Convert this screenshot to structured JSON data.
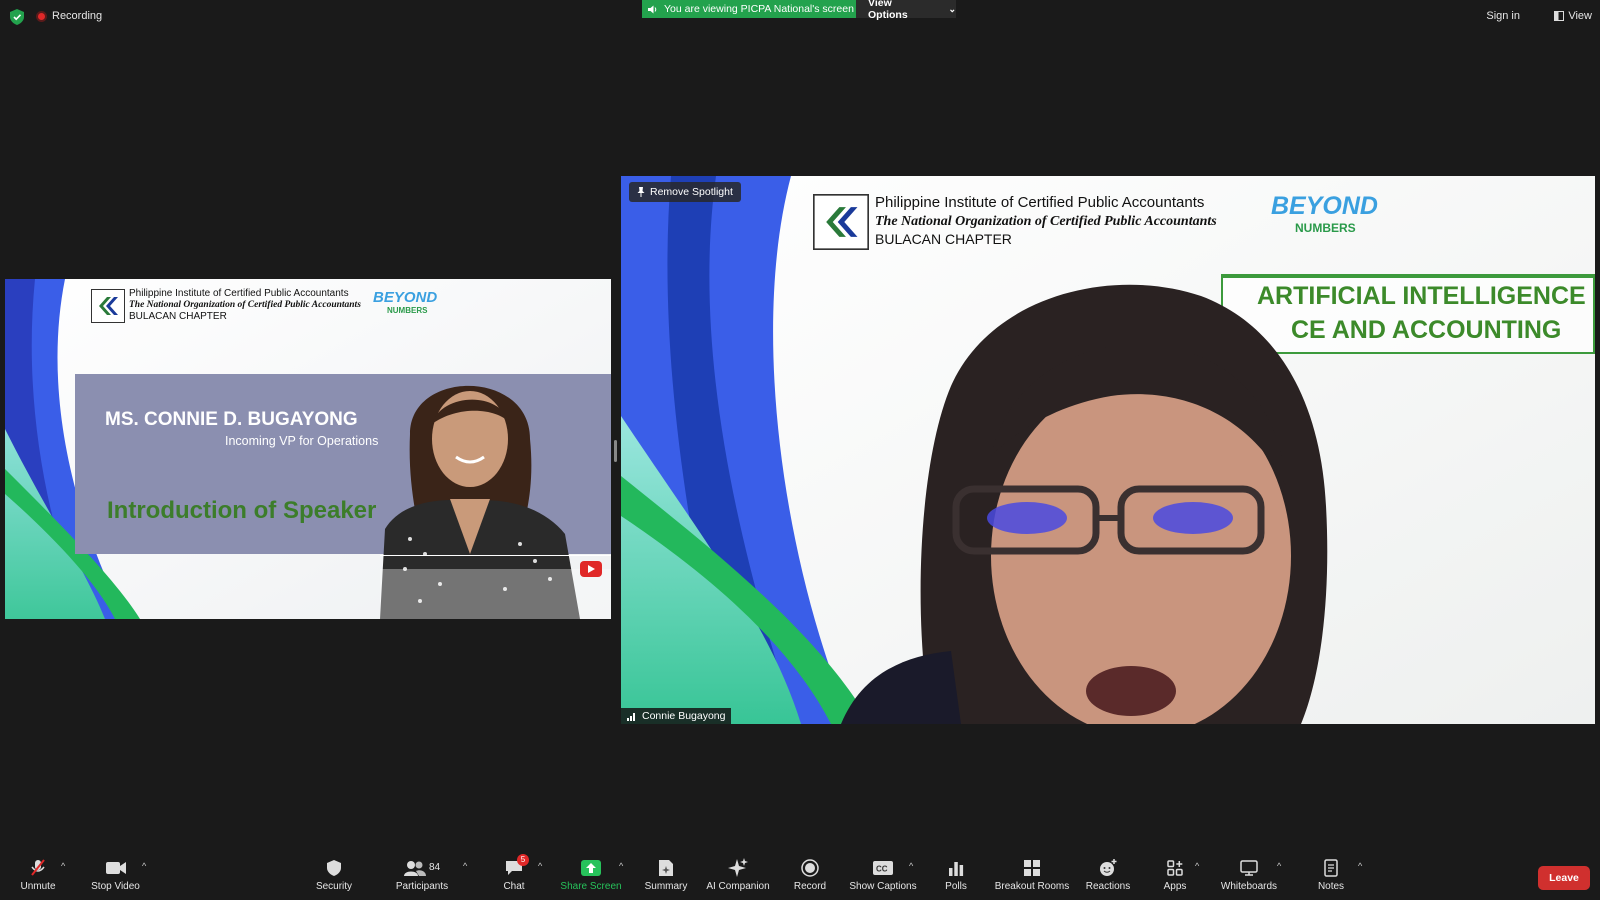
{
  "topbar": {
    "recording_label": "Recording",
    "viewing_banner": "You are viewing PICPA National's screen",
    "view_options_label": "View Options",
    "sign_in_label": "Sign in",
    "view_label": "View"
  },
  "left_tile": {
    "org_name": "Philippine Institute of Certified Public Accountants",
    "org_tagline": "The National Organization of Certified Public Accountants",
    "chapter": "BULACAN CHAPTER",
    "logo_text_1": "BEYOND",
    "logo_text_2": "NUMBERS",
    "speaker_name": "MS. CONNIE D. BUGAYONG",
    "speaker_role": "Incoming VP for Operations",
    "slide_title": "Introduction of Speaker"
  },
  "right_tile": {
    "spotlight_label": "Remove Spotlight",
    "org_name": "Philippine Institute of Certified Public Accountants",
    "org_tagline": "The National Organization of Certified Public Accountants",
    "chapter": "BULACAN CHAPTER",
    "logo_text_1": "BEYOND",
    "logo_text_2": "NUMBERS",
    "topic_line_1": "ARTIFICIAL INTELLIGENCE",
    "topic_line_2": "CE AND ACCOUNTING",
    "participant_name": "Connie Bugayong"
  },
  "toolbar": {
    "unmute": "Unmute",
    "stop_video": "Stop Video",
    "security": "Security",
    "participants": "Participants",
    "participants_count": "84",
    "chat": "Chat",
    "chat_badge": "5",
    "share_screen": "Share Screen",
    "summary": "Summary",
    "ai_companion": "AI Companion",
    "record": "Record",
    "show_captions": "Show Captions",
    "polls": "Polls",
    "breakout_rooms": "Breakout Rooms",
    "reactions": "Reactions",
    "apps": "Apps",
    "whiteboards": "Whiteboards",
    "notes": "Notes",
    "leave": "Leave"
  },
  "colors": {
    "share_green": "#23a24d",
    "leave_red": "#d0302e",
    "brand_blue": "#3a5ee8",
    "brand_green": "#23b85c"
  }
}
